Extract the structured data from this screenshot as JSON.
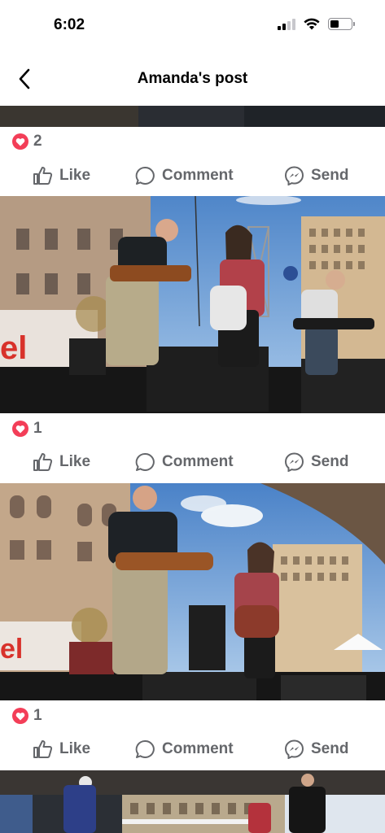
{
  "status_bar": {
    "time": "6:02",
    "battery_level": 0.4,
    "signal_bars": 2,
    "signal_bars_total": 4
  },
  "header": {
    "title": "Amanda's post",
    "back_icon": "chevron-left-icon"
  },
  "posts": [
    {
      "reaction_count": "2",
      "reaction_icon": "heart-icon"
    },
    {
      "reaction_count": "1",
      "reaction_icon": "heart-icon"
    },
    {
      "reaction_count": "1",
      "reaction_icon": "heart-icon"
    }
  ],
  "actions": {
    "like_label": "Like",
    "comment_label": "Comment",
    "send_label": "Send"
  },
  "colors": {
    "reaction_heart": "#f33e58",
    "action_text": "#65676b"
  }
}
